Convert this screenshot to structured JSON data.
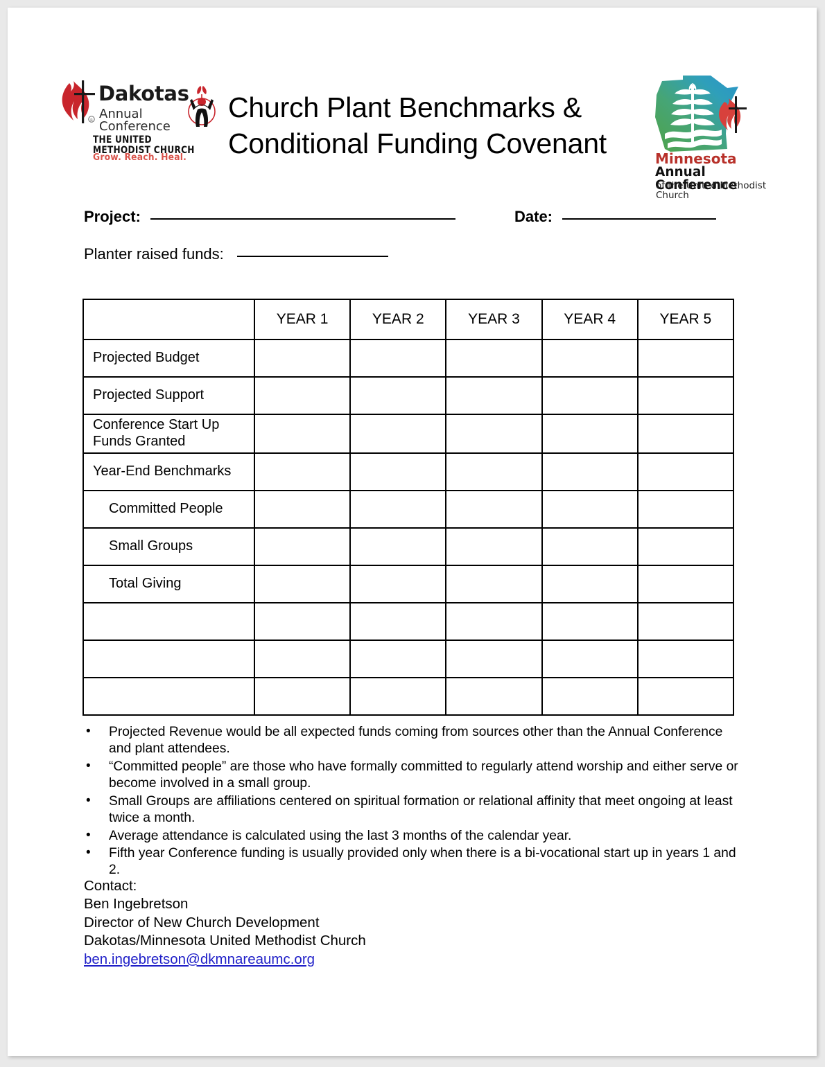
{
  "document": {
    "title_line1": "Church Plant Benchmarks &",
    "title_line2": "Conditional Funding Covenant"
  },
  "logos": {
    "dakotas": {
      "name": "Dakotas",
      "subtitle": "Annual Conference",
      "denomination": "THE UNITED METHODIST CHURCH",
      "tagline": "Grow. Reach. Heal.",
      "flame_icon": "umc-cross-and-flame-icon",
      "person_icon": "person-with-leaves-icon",
      "flame_color": "#c8252c",
      "tagline_color": "#d9544c"
    },
    "minnesota": {
      "name": "Minnesota",
      "subtitle": "Annual Conference",
      "denomination": "of the United Methodist Church",
      "state_icon": "minnesota-state-shape-icon",
      "flame_icon": "umc-cross-and-flame-icon",
      "gradient_start": "#5ba84f",
      "gradient_end": "#2e9fc4",
      "name_color": "#b8312a"
    }
  },
  "form": {
    "project_label": "Project:",
    "date_label": "Date:",
    "planter_label": "Planter raised funds:",
    "project_value": "",
    "date_value": "",
    "planter_value": ""
  },
  "table": {
    "corner_header": "",
    "column_headers": [
      "YEAR 1",
      "YEAR 2",
      "YEAR 3",
      "YEAR 4",
      "YEAR 5"
    ],
    "rows": [
      {
        "label": "Projected Budget",
        "indent": false,
        "two_line": false,
        "values": [
          "",
          "",
          "",
          "",
          ""
        ]
      },
      {
        "label": "Projected Support",
        "indent": false,
        "two_line": false,
        "values": [
          "",
          "",
          "",
          "",
          ""
        ]
      },
      {
        "label": "Conference Start Up\nFunds Granted",
        "indent": false,
        "two_line": true,
        "values": [
          "",
          "",
          "",
          "",
          ""
        ]
      },
      {
        "label": "Year-End Benchmarks",
        "indent": false,
        "two_line": false,
        "values": [
          "",
          "",
          "",
          "",
          ""
        ]
      },
      {
        "label": "Committed People",
        "indent": true,
        "two_line": false,
        "values": [
          "",
          "",
          "",
          "",
          ""
        ]
      },
      {
        "label": "Small Groups",
        "indent": true,
        "two_line": false,
        "values": [
          "",
          "",
          "",
          "",
          ""
        ]
      },
      {
        "label": "Total Giving",
        "indent": true,
        "two_line": false,
        "values": [
          "",
          "",
          "",
          "",
          ""
        ]
      },
      {
        "label": "",
        "indent": false,
        "two_line": false,
        "values": [
          "",
          "",
          "",
          "",
          ""
        ]
      },
      {
        "label": "",
        "indent": false,
        "two_line": false,
        "values": [
          "",
          "",
          "",
          "",
          ""
        ]
      },
      {
        "label": "",
        "indent": false,
        "two_line": false,
        "values": [
          "",
          "",
          "",
          "",
          ""
        ]
      }
    ]
  },
  "notes": {
    "bullet_glyph": "•",
    "items": [
      "Projected Revenue would be all expected funds coming from sources other than the Annual Conference and plant attendees.",
      "“Committed people” are those who have formally committed to regularly attend worship and either serve or become involved in a small group.",
      "Small Groups are affiliations centered on spiritual formation or relational affinity that meet ongoing at least twice a month.",
      "Average attendance is calculated using the last 3 months of the calendar year.",
      "Fifth year Conference funding is usually provided only when there is a bi-vocational start up in years 1 and 2."
    ]
  },
  "contact": {
    "heading": "Contact:",
    "name": "Ben Ingebretson",
    "role": "Director of New Church Development",
    "organization": "Dakotas/Minnesota United Methodist Church",
    "email": "ben.ingebretson@dkmnareaumc.org",
    "email_color": "#1f1fc8"
  }
}
